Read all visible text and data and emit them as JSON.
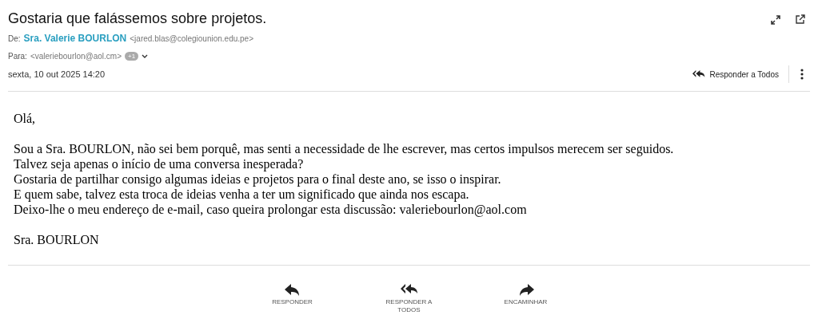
{
  "subject": "Gostaria que falássemos sobre projetos.",
  "from": {
    "label": "De:",
    "name": "Sra. Valerie BOURLON",
    "address": "<jared.blas@colegiounion.edu.pe>"
  },
  "to": {
    "label": "Para:",
    "address": "<valeriebourlon@aol.cm>",
    "extra_count": "+1"
  },
  "date": "sexta, 10 out 2025 14:20",
  "reply_all_button": "Responder a Todos",
  "body": {
    "greeting": "Olá,",
    "lines": [
      "Sou a Sra. BOURLON, não sei bem porquê, mas senti a necessidade de lhe escrever, mas certos impulsos merecem ser seguidos.",
      "Talvez seja apenas o início de uma conversa inesperada?",
      "Gostaria de partilhar consigo algumas ideias e projetos para o final deste ano, se isso o inspirar.",
      "E quem sabe, talvez esta troca de ideias venha a ter um significado que ainda nos escapa.",
      "Deixo-lhe o meu endereço de e-mail, caso queira prolongar esta discussão: valeriebourlon@aol.com"
    ],
    "signature": "Sra. BOURLON"
  },
  "actions": [
    {
      "kind": "reply",
      "label": "RESPONDER"
    },
    {
      "kind": "reply_all",
      "label": "RESPONDER A TODOS"
    },
    {
      "kind": "forward",
      "label": "ENCAMINHAR"
    }
  ]
}
